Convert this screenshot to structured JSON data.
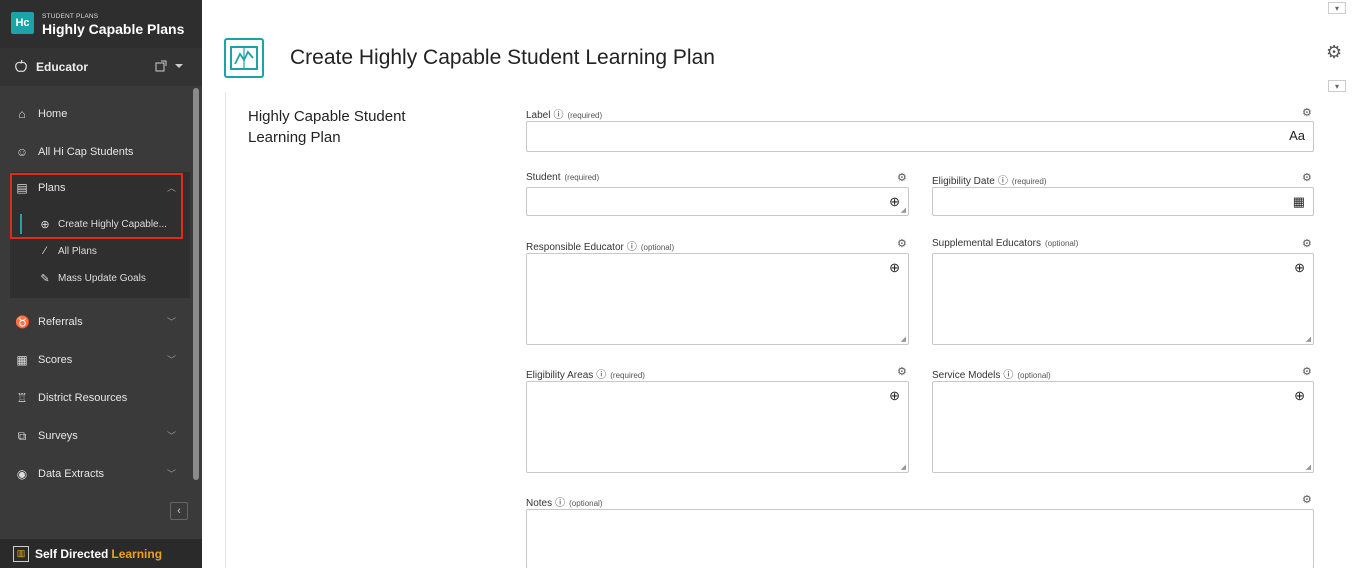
{
  "brand": {
    "logo": "Hc",
    "subtitle": "STUDENT PLANS",
    "title": "Highly Capable Plans"
  },
  "role": {
    "icon": "apple-icon",
    "label": "Educator",
    "caret": "▾"
  },
  "nav": {
    "home": "Home",
    "all_students": "All Hi Cap Students",
    "plans": "Plans",
    "plans_children": {
      "create": "Create Highly Capable...",
      "all_plans": "All Plans",
      "mass_update": "Mass Update Goals"
    },
    "referrals": "Referrals",
    "scores": "Scores",
    "district_resources": "District Resources",
    "surveys": "Surveys",
    "data_extracts": "Data Extracts"
  },
  "footer": {
    "part1": "Self Directed",
    "part2": "Learning"
  },
  "header": {
    "title": "Create Highly Capable Student Learning Plan"
  },
  "form": {
    "section_title": "Highly Capable Student Learning Plan",
    "label": {
      "label": "Label",
      "req": "(required)",
      "suffix": "Aa"
    },
    "student": {
      "label": "Student",
      "req": "(required)"
    },
    "eligibility_date": {
      "label": "Eligibility Date",
      "req": "(required)"
    },
    "responsible_educator": {
      "label": "Responsible Educator",
      "req": "(optional)"
    },
    "supplemental_educators": {
      "label": "Supplemental Educators",
      "req": "(optional)"
    },
    "eligibility_areas": {
      "label": "Eligibility Areas",
      "req": "(required)"
    },
    "service_models": {
      "label": "Service Models",
      "req": "(optional)"
    },
    "notes": {
      "label": "Notes",
      "req": "(optional)"
    }
  },
  "colors": {
    "accent": "#1aa3a8",
    "highlight": "#e02a20",
    "footer_accent": "#e8a21c"
  }
}
